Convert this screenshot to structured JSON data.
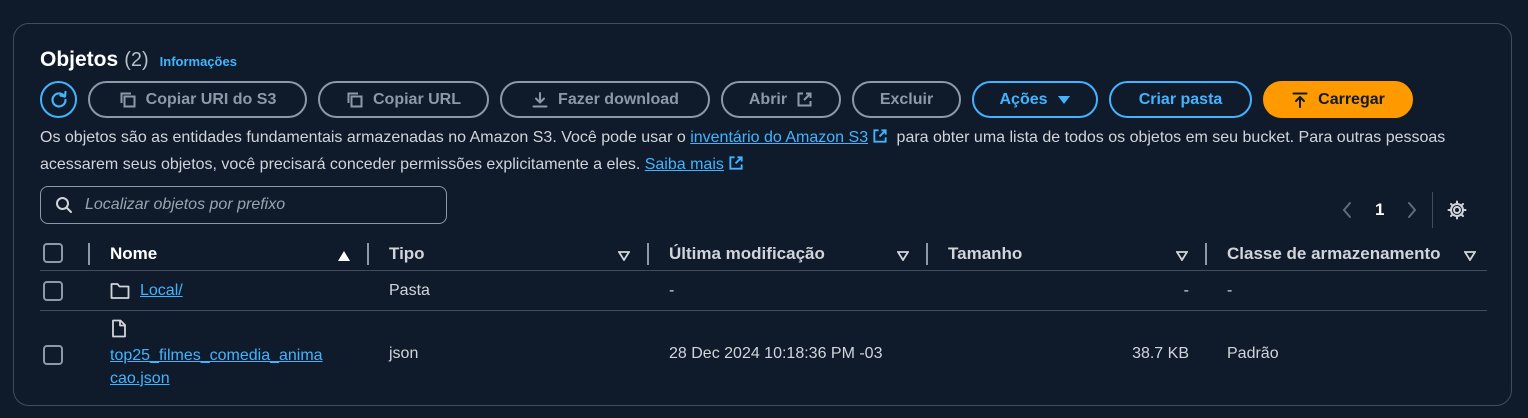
{
  "header": {
    "title": "Objetos",
    "count": "(2)",
    "info_link": "Informações"
  },
  "toolbar": {
    "copy_uri": "Copiar URI do S3",
    "copy_url": "Copiar URL",
    "download": "Fazer download",
    "open": "Abrir",
    "delete": "Excluir",
    "actions": "Ações",
    "create_folder": "Criar pasta",
    "upload": "Carregar"
  },
  "description": {
    "part1": "Os objetos são as entidades fundamentais armazenadas no Amazon S3. Você pode usar o ",
    "link1": "inventário do Amazon S3",
    "part2": " para obter uma lista de todos os objetos em seu bucket. Para outras pessoas acessarem seus objetos, você precisará conceder permissões explicitamente a eles. ",
    "link2": "Saiba mais"
  },
  "search": {
    "placeholder": "Localizar objetos por prefixo"
  },
  "pagination": {
    "current_page": "1"
  },
  "table": {
    "columns": [
      "Nome",
      "Tipo",
      "Última modificação",
      "Tamanho",
      "Classe de armazenamento"
    ],
    "rows": [
      {
        "name": "Local/",
        "type": "Pasta",
        "modified": "-",
        "size": "-",
        "storage_class": "-"
      },
      {
        "name_line1": "top25_filmes_comedia_anima",
        "name_line2": "cao.json",
        "type": "json",
        "modified": "28 Dec 2024 10:18:36 PM -03",
        "size": "38.7 KB",
        "storage_class": "Padrão"
      }
    ]
  },
  "colors": {
    "accent": "#42b4ff",
    "primary_button": "#ff9900",
    "background": "#0f1b2a",
    "border": "#414d5c"
  },
  "icons": [
    "refresh-icon",
    "copy-icon",
    "download-icon",
    "external-link-icon",
    "caret-down-icon",
    "upload-icon",
    "search-icon",
    "chevron-left-icon",
    "chevron-right-icon",
    "settings-gear-icon",
    "sort-asc-icon",
    "sort-desc-icon",
    "folder-icon",
    "file-icon"
  ]
}
